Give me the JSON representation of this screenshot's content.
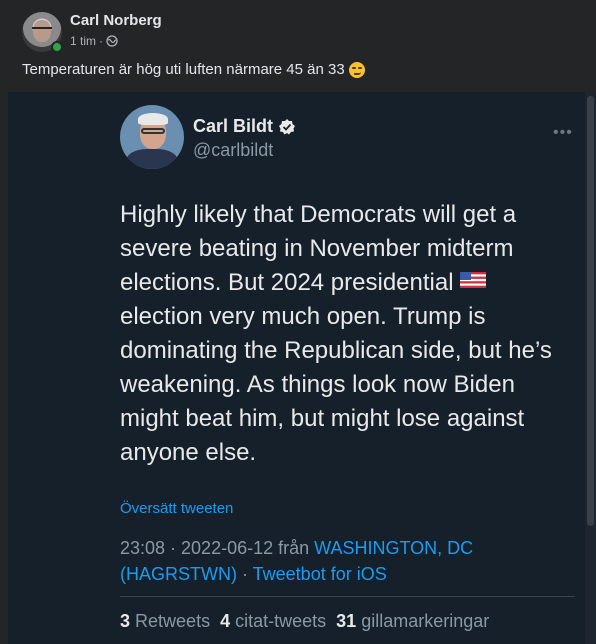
{
  "post": {
    "author": "Carl Norberg",
    "time": "1 tim",
    "separator": "·",
    "text": "Temperaturen är hög uti luften närmare 45 än 33"
  },
  "tweet": {
    "name": "Carl Bildt",
    "handle": "@carlbildt",
    "body_part1": "Highly likely that Democrats will get a severe beating in November midterm elections. But 2024 presidential ",
    "body_part2": " election very much open. Trump is dominating the Republican side, but he’s weakening. As things look now Biden might beat him, but might lose against anyone else.",
    "translate": "Översätt tweeten",
    "timestamp": "23:08 · 2022-06-12 från ",
    "location": "WASHINGTON, DC (HAGRSTWN)",
    "via_sep": " · ",
    "client": "Tweetbot for iOS",
    "stats": {
      "retweets_count": "3",
      "retweets_label": "Retweets",
      "quotes_count": "4",
      "quotes_label": "citat-tweets",
      "likes_count": "31",
      "likes_label": "gillamarkeringar"
    }
  },
  "colors": {
    "fb_bg": "#242526",
    "tweet_bg": "#15202b",
    "link": "#1d9bf0",
    "online": "#31a24c"
  },
  "icons": [
    "globe-icon",
    "smirk-emoji",
    "verified-icon",
    "us-flag-icon",
    "more-icon"
  ]
}
